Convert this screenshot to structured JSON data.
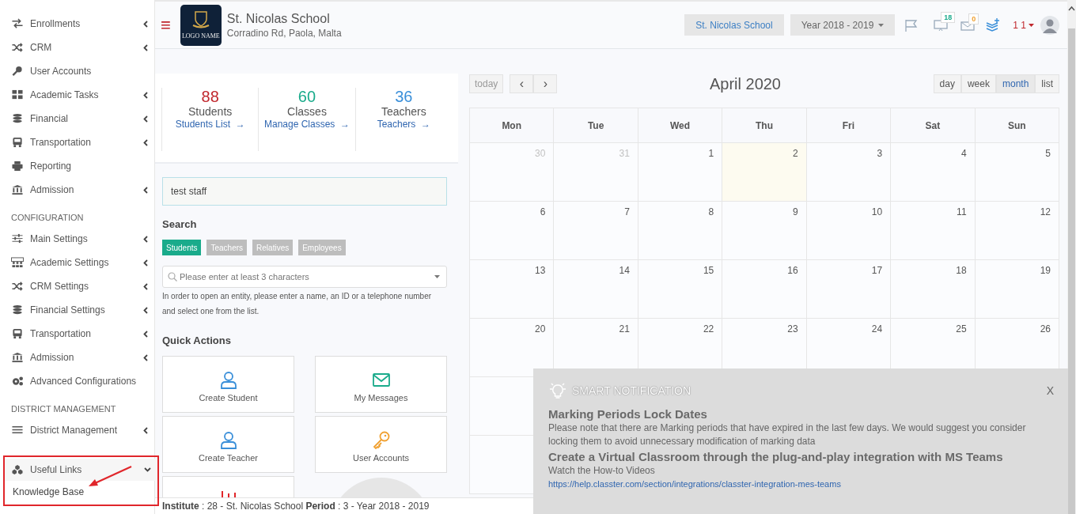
{
  "sidebar": {
    "groups": [
      {
        "items": [
          {
            "label": "Enrollments",
            "expanded": false
          },
          {
            "label": "CRM",
            "expanded": false
          },
          {
            "label": "User Accounts"
          },
          {
            "label": "Academic Tasks",
            "expanded": false
          },
          {
            "label": "Financial",
            "expanded": false
          },
          {
            "label": "Transportation",
            "expanded": false
          },
          {
            "label": "Reporting"
          },
          {
            "label": "Admission",
            "expanded": false
          }
        ]
      },
      {
        "heading": "CONFIGURATION",
        "items": [
          {
            "label": "Main Settings",
            "expanded": false
          },
          {
            "label": "Academic Settings",
            "expanded": false
          },
          {
            "label": "CRM Settings",
            "expanded": false
          },
          {
            "label": "Financial Settings",
            "expanded": false
          },
          {
            "label": "Transportation",
            "expanded": false
          },
          {
            "label": "Admission",
            "expanded": false
          },
          {
            "label": "Advanced Configurations"
          }
        ]
      },
      {
        "heading": "DISTRICT MANAGEMENT",
        "items": [
          {
            "label": "District Management",
            "expanded": false
          }
        ]
      },
      {
        "items": [
          {
            "label": "Useful Links",
            "expanded": true,
            "highlighted": true,
            "children": [
              {
                "label": "Knowledge Base"
              }
            ]
          }
        ]
      }
    ]
  },
  "header": {
    "menu_glyph": "≡",
    "logo_text": "LOGO NAME",
    "school_name": "St. Nicolas School",
    "address": "Corradino Rd, Paola, Malta",
    "school_button": "St. Nicolas School",
    "year_select": "Year 2018 - 2019",
    "alerts_badge": "18",
    "messages_badge": "0",
    "user_count": "1 1"
  },
  "stats": [
    {
      "value": "88",
      "label": "Students",
      "link": "Students List",
      "arrow": "→",
      "color": "#c0272d"
    },
    {
      "value": "60",
      "label": "Classes",
      "link": "Manage Classes",
      "arrow": "→",
      "color": "#1aab8b"
    },
    {
      "value": "36",
      "label": "Teachers",
      "link": "Teachers",
      "arrow": "→",
      "color": "#3a8fd9"
    }
  ],
  "quick_search": {
    "value": "test staff"
  },
  "search": {
    "title": "Search",
    "tabs": [
      {
        "label": "Students",
        "selected": true
      },
      {
        "label": "Teachers",
        "selected": false
      },
      {
        "label": "Relatives",
        "selected": false
      },
      {
        "label": "Employees",
        "selected": false
      }
    ],
    "placeholder": "Please enter at least 3 characters",
    "hint": "In order to open an entity, please enter a name, an ID or a telephone number and select one from the list."
  },
  "quick_actions": {
    "title": "Quick Actions",
    "items": [
      {
        "label": "Create Student"
      },
      {
        "label": "My Messages"
      },
      {
        "label": "Create Teacher"
      },
      {
        "label": "User Accounts"
      }
    ]
  },
  "calendar": {
    "today_button": "today",
    "prev": "‹",
    "next": "›",
    "title": "April 2020",
    "views": [
      {
        "label": "day",
        "selected": false
      },
      {
        "label": "week",
        "selected": false
      },
      {
        "label": "month",
        "selected": true
      },
      {
        "label": "list",
        "selected": false
      }
    ],
    "weekdays": [
      "Mon",
      "Tue",
      "Wed",
      "Thu",
      "Fri",
      "Sat",
      "Sun"
    ],
    "weeks": [
      [
        {
          "day": "30",
          "other_month": true,
          "today": false
        },
        {
          "day": "31",
          "other_month": true,
          "today": false
        },
        {
          "day": "1",
          "other_month": false,
          "today": false
        },
        {
          "day": "2",
          "other_month": false,
          "today": true
        },
        {
          "day": "3",
          "other_month": false,
          "today": false
        },
        {
          "day": "4",
          "other_month": false,
          "today": false
        },
        {
          "day": "5",
          "other_month": false,
          "today": false
        }
      ],
      [
        {
          "day": "6",
          "other_month": false,
          "today": false
        },
        {
          "day": "7",
          "other_month": false,
          "today": false
        },
        {
          "day": "8",
          "other_month": false,
          "today": false
        },
        {
          "day": "9",
          "other_month": false,
          "today": false
        },
        {
          "day": "10",
          "other_month": false,
          "today": false
        },
        {
          "day": "11",
          "other_month": false,
          "today": false
        },
        {
          "day": "12",
          "other_month": false,
          "today": false
        }
      ],
      [
        {
          "day": "13",
          "other_month": false,
          "today": false
        },
        {
          "day": "14",
          "other_month": false,
          "today": false
        },
        {
          "day": "15",
          "other_month": false,
          "today": false
        },
        {
          "day": "16",
          "other_month": false,
          "today": false
        },
        {
          "day": "17",
          "other_month": false,
          "today": false
        },
        {
          "day": "18",
          "other_month": false,
          "today": false
        },
        {
          "day": "19",
          "other_month": false,
          "today": false
        }
      ],
      [
        {
          "day": "20",
          "other_month": false,
          "today": false
        },
        {
          "day": "21",
          "other_month": false,
          "today": false
        },
        {
          "day": "22",
          "other_month": false,
          "today": false
        },
        {
          "day": "23",
          "other_month": false,
          "today": false
        },
        {
          "day": "24",
          "other_month": false,
          "today": false
        },
        {
          "day": "25",
          "other_month": false,
          "today": false
        },
        {
          "day": "26",
          "other_month": false,
          "today": false
        }
      ]
    ]
  },
  "notification": {
    "title": "SMART NOTIFICATION",
    "close": "X",
    "items": [
      {
        "heading": "Marking Periods Lock Dates",
        "text": "Please note that there are Marking periods that have expired in the last few days. We would suggest you consider locking them to avoid unnecessary modification of marking data"
      },
      {
        "heading": "Create a Virtual Classroom through the plug-and-play integration with MS Teams",
        "text": "Watch the How-to Videos",
        "link": "https://help.classter.com/section/integrations/classter-integration-mes-teams"
      }
    ]
  },
  "footer": {
    "text": "**Institute** : 28 - St. Nicolas School **Period** : 3 - Year 2018 - 2019"
  }
}
